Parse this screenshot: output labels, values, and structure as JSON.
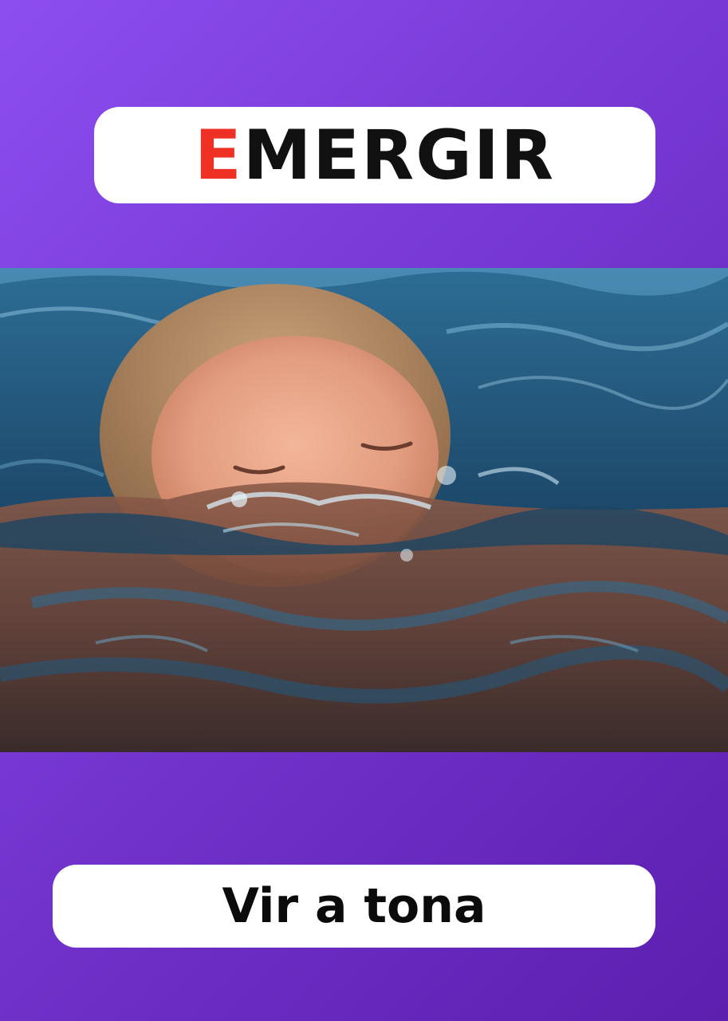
{
  "card": {
    "title_first_letter": "E",
    "title_rest": "MERGIR",
    "caption": "Vir a tona"
  },
  "colors": {
    "background_start": "#8d4ef0",
    "background_end": "#5c1fae",
    "title_accent": "#ee3124",
    "title_text": "#111111",
    "pill_background": "#ffffff"
  },
  "photo": {
    "icon": "child-surfacing-from-water-photo"
  }
}
